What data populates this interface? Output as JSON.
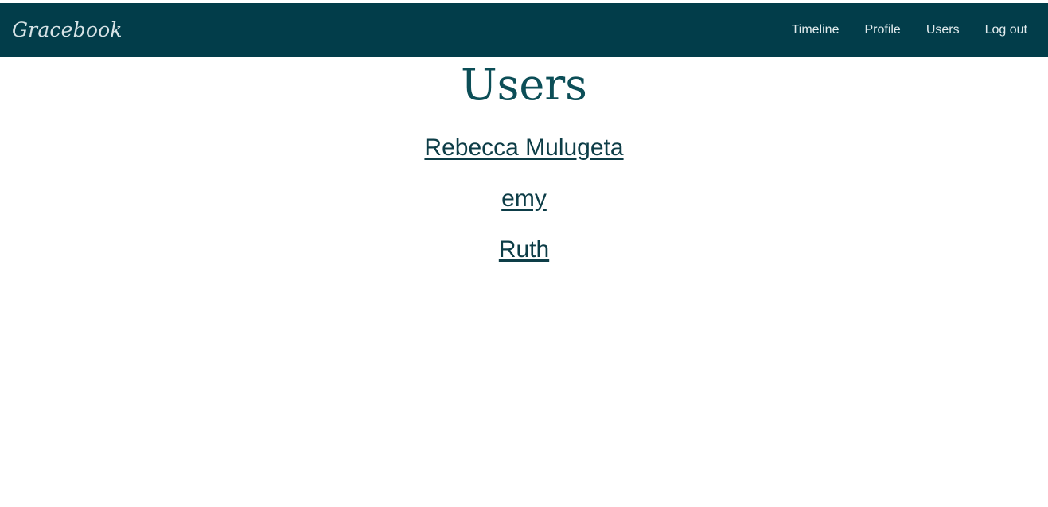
{
  "navbar": {
    "brand": "Gracebook",
    "links": [
      {
        "label": "Timeline"
      },
      {
        "label": "Profile"
      },
      {
        "label": "Users"
      },
      {
        "label": "Log out"
      }
    ]
  },
  "page": {
    "title": "Users",
    "users": [
      {
        "name": "Rebecca Mulugeta"
      },
      {
        "name": "emy"
      },
      {
        "name": "Ruth"
      }
    ]
  },
  "colors": {
    "navbar_background": "#023d4a",
    "title_color": "#0c4e57",
    "link_color": "#0d3d47"
  }
}
